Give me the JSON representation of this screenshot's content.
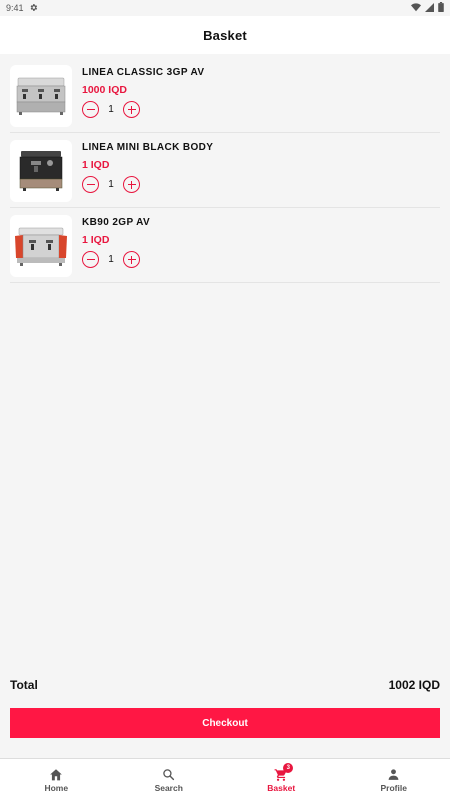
{
  "status_bar": {
    "time": "9:41"
  },
  "app_bar": {
    "title": "Basket"
  },
  "basket": {
    "items": [
      {
        "name": "LINEA CLASSIC 3GP AV",
        "price": "1000 IQD",
        "quantity": "1"
      },
      {
        "name": "LINEA MINI BLACK BODY",
        "price": "1 IQD",
        "quantity": "1"
      },
      {
        "name": "KB90 2GP AV",
        "price": "1 IQD",
        "quantity": "1"
      }
    ]
  },
  "summary": {
    "total_label": "Total",
    "total_value": "1002 IQD"
  },
  "checkout": {
    "label": "Checkout"
  },
  "bottom_nav": {
    "items": [
      {
        "label": "Home",
        "icon": "home-icon"
      },
      {
        "label": "Search",
        "icon": "search-icon"
      },
      {
        "label": "Basket",
        "icon": "cart-icon",
        "badge": "3"
      },
      {
        "label": "Profile",
        "icon": "person-icon"
      }
    ],
    "active": "Basket"
  },
  "colors": {
    "accent": "#e8163f",
    "button": "#ff1744"
  }
}
